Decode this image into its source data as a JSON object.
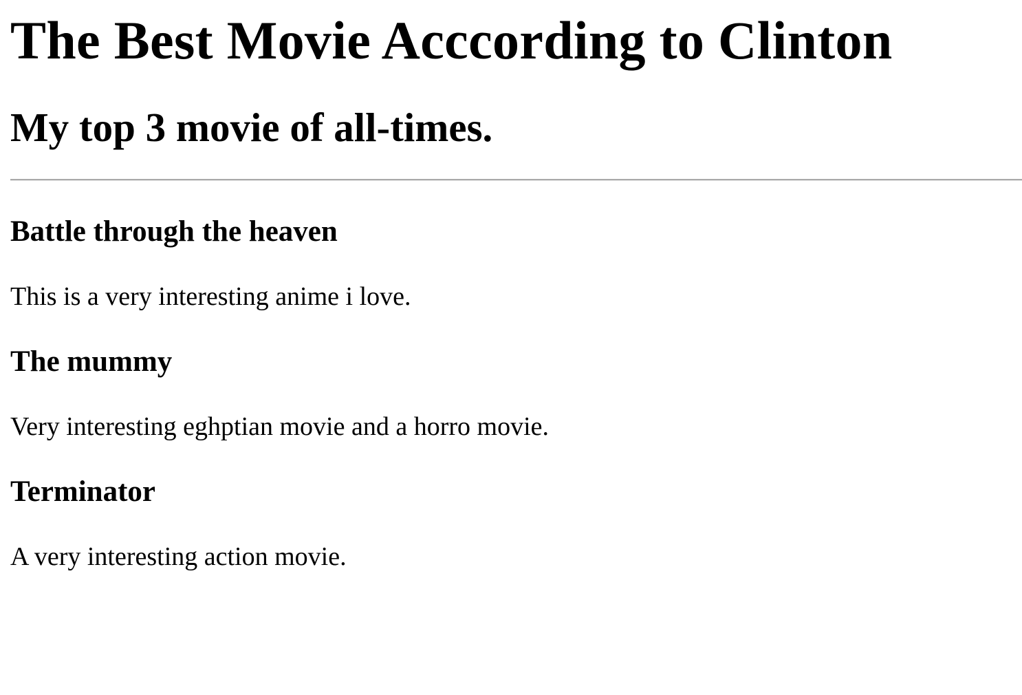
{
  "page": {
    "title": "The Best Movie Acccording to Clinton",
    "subtitle": "My top 3 movie of all-times."
  },
  "movies": [
    {
      "title": "Battle through the heaven",
      "description": "This is a very interesting anime i love."
    },
    {
      "title": "The mummy",
      "description": "Very interesting eghptian movie and a horro movie."
    },
    {
      "title": "Terminator",
      "description": "A very interesting action movie."
    }
  ]
}
